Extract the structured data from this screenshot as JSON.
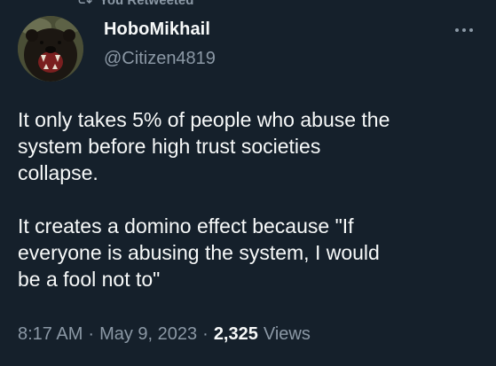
{
  "banner": {
    "text": "You Retweeted"
  },
  "author": {
    "display_name": "HoboMikhail",
    "handle": "@Citizen4819"
  },
  "tweet": {
    "paragraphs": [
      "It only takes 5% of people who abuse the\nsystem before high trust societies\ncollapse.",
      "It creates a domino effect because \"If\neveryone is abusing the system, I would\nbe a fool not to\""
    ]
  },
  "meta": {
    "time": "8:17 AM",
    "separator": "·",
    "date": "May 9, 2023",
    "views_count": "2,325",
    "views_label": "Views"
  },
  "colors": {
    "background": "#15202b",
    "text_primary": "#f7f9f9",
    "text_secondary": "#8b98a5"
  },
  "icons": {
    "retweet": "retweet-icon",
    "more": "more-icon"
  }
}
